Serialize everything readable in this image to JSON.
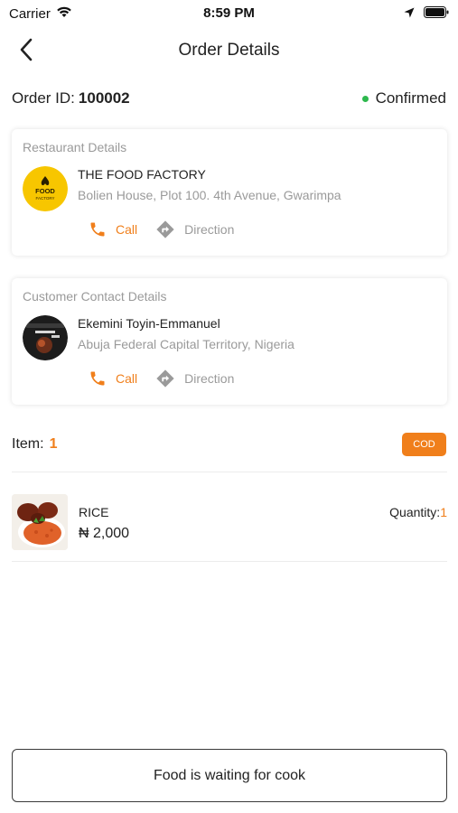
{
  "status_bar": {
    "carrier": "Carrier",
    "time": "8:59 PM",
    "icons": [
      "wifi-icon",
      "location-arrow-icon",
      "battery-icon"
    ]
  },
  "nav": {
    "title": "Order Details",
    "back_icon": "chevron-left-icon"
  },
  "order": {
    "id_label": "Order ID:",
    "id_value": "100002",
    "status": "Confirmed",
    "status_color": "#2db84d"
  },
  "restaurant": {
    "heading": "Restaurant Details",
    "name": "THE FOOD FACTORY",
    "address": "Bolien House, Plot 100. 4th Avenue, Gwarimpa",
    "logo_text_top": "FOOD",
    "logo_text_bottom": "FACTORY",
    "call_label": "Call",
    "direction_label": "Direction"
  },
  "customer": {
    "heading": "Customer Contact Details",
    "name": "Ekemini Toyin-Emmanuel",
    "address": "Abuja Federal Capital Territory, Nigeria",
    "call_label": "Call",
    "direction_label": "Direction"
  },
  "items": {
    "label": "Item:",
    "count": "1",
    "payment_badge": "COD",
    "list": [
      {
        "name": "RICE",
        "price": "₦ 2,000",
        "quantity_label": "Quantity:",
        "quantity": "1"
      }
    ]
  },
  "footer": {
    "button_label": "Food is waiting for cook"
  },
  "colors": {
    "accent": "#f07f1b",
    "muted": "#9a9a9a",
    "logo_yellow": "#f7c600"
  }
}
